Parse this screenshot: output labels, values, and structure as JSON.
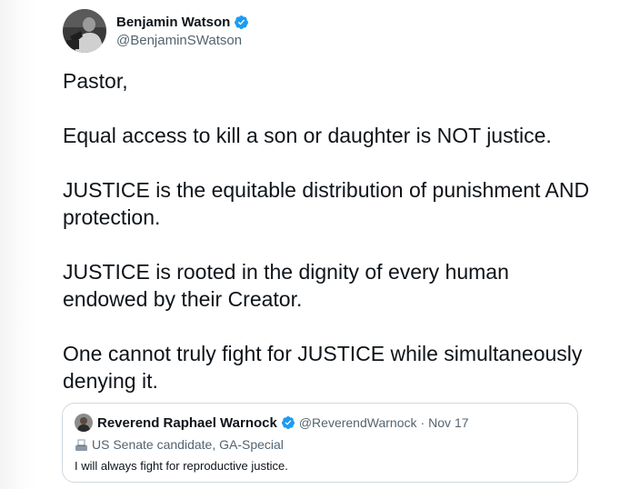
{
  "author": {
    "display_name": "Benjamin Watson",
    "handle": "@BenjaminSWatson",
    "verified": true,
    "avatar_icon": "profile-photo"
  },
  "tweet": {
    "paragraphs": [
      "Pastor,",
      "Equal access to kill a son or daughter is NOT justice.",
      "JUSTICE is the equitable distribution of punishment AND protection.",
      "JUSTICE is rooted in the dignity of every human endowed by their Creator.",
      "One cannot truly fight for JUSTICE while simultaneously denying it."
    ]
  },
  "quoted_tweet": {
    "display_name": "Reverend Raphael Warnock",
    "handle": "@ReverendWarnock",
    "separator": "·",
    "date": "Nov 17",
    "verified": true,
    "label_icon": "ballot-box-icon",
    "label": "US Senate candidate, GA-Special",
    "text": "I will always fight for reproductive justice."
  },
  "colors": {
    "verified_blue": "#1d9bf0",
    "secondary_text": "#536471",
    "primary_text": "#0f1419",
    "card_border": "#cfd9de"
  }
}
